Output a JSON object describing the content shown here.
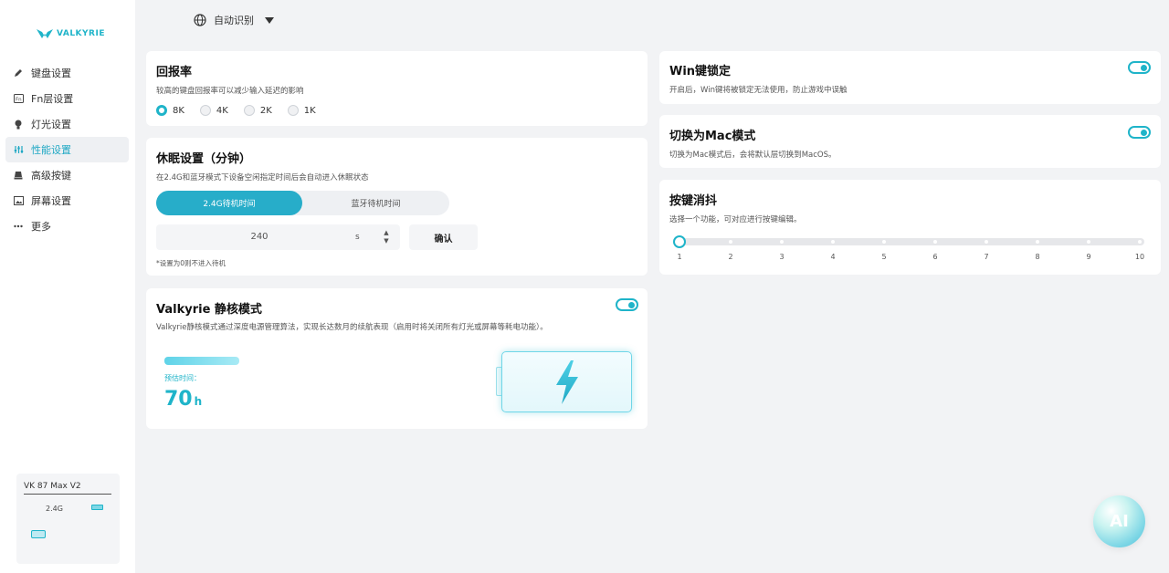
{
  "app": {
    "logo_text": "VALKYRIE"
  },
  "language": {
    "label": "自动识别"
  },
  "sidebar": {
    "items": [
      {
        "label": "键盘设置",
        "icon": "pencil-icon"
      },
      {
        "label": "Fn层设置",
        "icon": "fn-icon"
      },
      {
        "label": "灯光设置",
        "icon": "bulb-icon"
      },
      {
        "label": "性能设置",
        "icon": "sliders-icon",
        "active": true
      },
      {
        "label": "高级按键",
        "icon": "key-icon"
      },
      {
        "label": "屏幕设置",
        "icon": "screen-icon"
      },
      {
        "label": "更多",
        "icon": "more-icon"
      }
    ]
  },
  "device": {
    "name": "VK 87 Max V2",
    "connection": "2.4G"
  },
  "polling": {
    "title": "回报率",
    "desc": "较高的键盘回报率可以减少输入延迟的影响",
    "options": [
      "8K",
      "4K",
      "2K",
      "1K"
    ],
    "selected": "8K"
  },
  "sleep": {
    "title": "休眠设置（分钟）",
    "desc": "在2.4G和蓝牙模式下设备空闲指定时间后会自动进入休眠状态",
    "tab_active": "2.4G待机时间",
    "tab_inactive": "蓝牙待机时间",
    "value": "240",
    "unit": "s",
    "confirm": "确认",
    "note": "*设置为0则不进入待机"
  },
  "eco": {
    "title": "Valkyrie 静核模式",
    "desc": "Valkyrie静核模式通过深度电源管理算法，实现长达数月的续航表现（启用时将关闭所有灯光或屏幕等耗电功能）。",
    "est_label": "预估时间：",
    "est_value": "70",
    "est_unit": "h",
    "enabled": true
  },
  "winlock": {
    "title": "Win键锁定",
    "desc": "开启后，Win键将被锁定无法使用，防止游戏中误触",
    "enabled": true
  },
  "mac": {
    "title": "切换为Mac模式",
    "desc": "切换为Mac模式后，会将默认层切换到MacOS。",
    "enabled": true
  },
  "debounce": {
    "title": "按键消抖",
    "desc": "选择一个功能，可对应进行按键编辑。",
    "labels": [
      "1",
      "2",
      "3",
      "4",
      "5",
      "6",
      "7",
      "8",
      "9",
      "10"
    ],
    "value": 1
  },
  "ai": {
    "label": "AI"
  },
  "colors": {
    "accent": "#1fb4c9",
    "background": "#f2f3f5"
  }
}
